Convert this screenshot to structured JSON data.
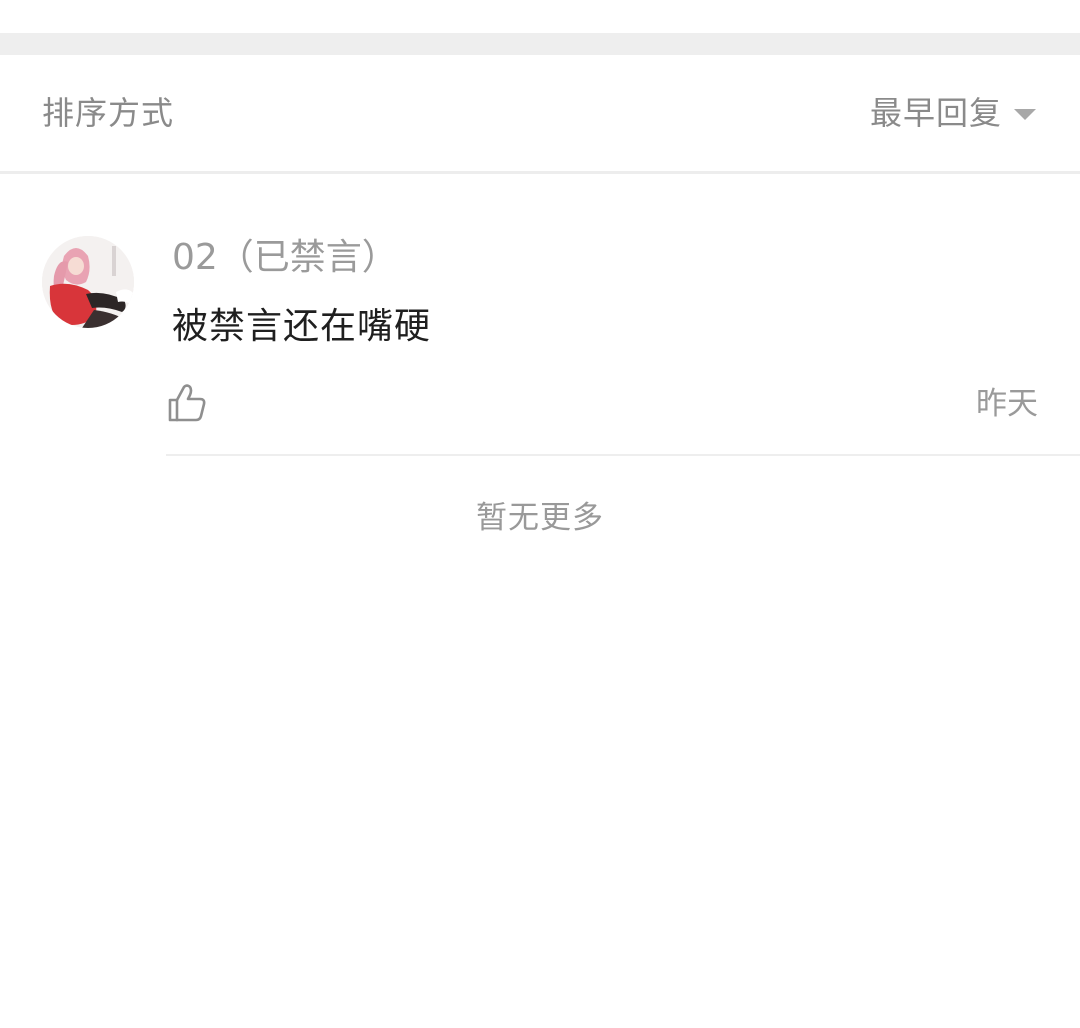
{
  "sort_bar": {
    "label": "排序方式",
    "selected": "最早回复",
    "caret_icon": "caret-down-icon"
  },
  "comments": [
    {
      "username": "02（已禁言）",
      "text": "被禁言还在嘴硬",
      "time": "昨天",
      "like_icon": "thumbs-up-icon"
    }
  ],
  "list_footer": {
    "text": "暂无更多"
  },
  "colors": {
    "background": "#ffffff",
    "separator": "#eeeeee",
    "secondary_text": "#8a8a8a",
    "primary_text": "#1f1f1f"
  }
}
